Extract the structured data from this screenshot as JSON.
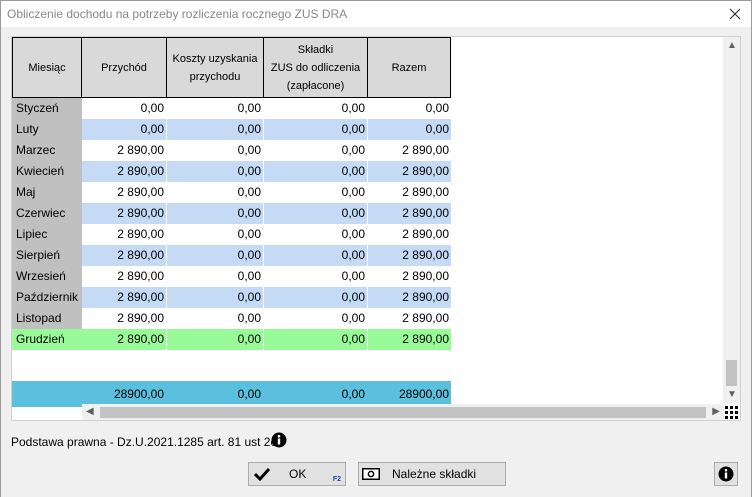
{
  "window": {
    "title": "Obliczenie dochodu na potrzeby rozliczenia rocznego ZUS DRA"
  },
  "table": {
    "headers": {
      "month": "Miesiąc",
      "income": "Przychód",
      "costs_line1": "Koszty uzyskania",
      "costs_line2": "przychodu",
      "contrib_line1": "Składki",
      "contrib_line2": "ZUS do odliczenia",
      "contrib_line3": "(zapłacone)",
      "total": "Razem"
    },
    "rows": [
      {
        "month": "Styczeń",
        "income": "0,00",
        "costs": "0,00",
        "contrib": "0,00",
        "total": "0,00"
      },
      {
        "month": "Luty",
        "income": "0,00",
        "costs": "0,00",
        "contrib": "0,00",
        "total": "0,00"
      },
      {
        "month": "Marzec",
        "income": "2 890,00",
        "costs": "0,00",
        "contrib": "0,00",
        "total": "2 890,00"
      },
      {
        "month": "Kwiecień",
        "income": "2 890,00",
        "costs": "0,00",
        "contrib": "0,00",
        "total": "2 890,00"
      },
      {
        "month": "Maj",
        "income": "2 890,00",
        "costs": "0,00",
        "contrib": "0,00",
        "total": "2 890,00"
      },
      {
        "month": "Czerwiec",
        "income": "2 890,00",
        "costs": "0,00",
        "contrib": "0,00",
        "total": "2 890,00"
      },
      {
        "month": "Lipiec",
        "income": "2 890,00",
        "costs": "0,00",
        "contrib": "0,00",
        "total": "2 890,00"
      },
      {
        "month": "Sierpień",
        "income": "2 890,00",
        "costs": "0,00",
        "contrib": "0,00",
        "total": "2 890,00"
      },
      {
        "month": "Wrzesień",
        "income": "2 890,00",
        "costs": "0,00",
        "contrib": "0,00",
        "total": "2 890,00"
      },
      {
        "month": "Październik",
        "income": "2 890,00",
        "costs": "0,00",
        "contrib": "0,00",
        "total": "2 890,00"
      },
      {
        "month": "Listopad",
        "income": "2 890,00",
        "costs": "0,00",
        "contrib": "0,00",
        "total": "2 890,00"
      },
      {
        "month": "Grudzień",
        "income": "2 890,00",
        "costs": "0,00",
        "contrib": "0,00",
        "total": "2 890,00"
      }
    ],
    "totals": {
      "income": "28900,00",
      "costs": "0,00",
      "contrib": "0,00",
      "total": "28900,00"
    }
  },
  "footer": {
    "legal_basis": "Podstawa prawna - Dz.U.2021.1285 art. 81 ust 2c.",
    "ok_label": "OK",
    "ok_shortcut": "F2",
    "due_label": "Należne składki"
  },
  "colors": {
    "row_alt": "#c5daf5",
    "row_active": "#98fb98",
    "totals_bar": "#5bc0de",
    "header_bg": "#d9d9d9"
  },
  "icons": {
    "close": "close-icon",
    "info": "info-icon",
    "ok": "checkmark-icon",
    "due": "money-icon",
    "grid": "grid-icon"
  }
}
